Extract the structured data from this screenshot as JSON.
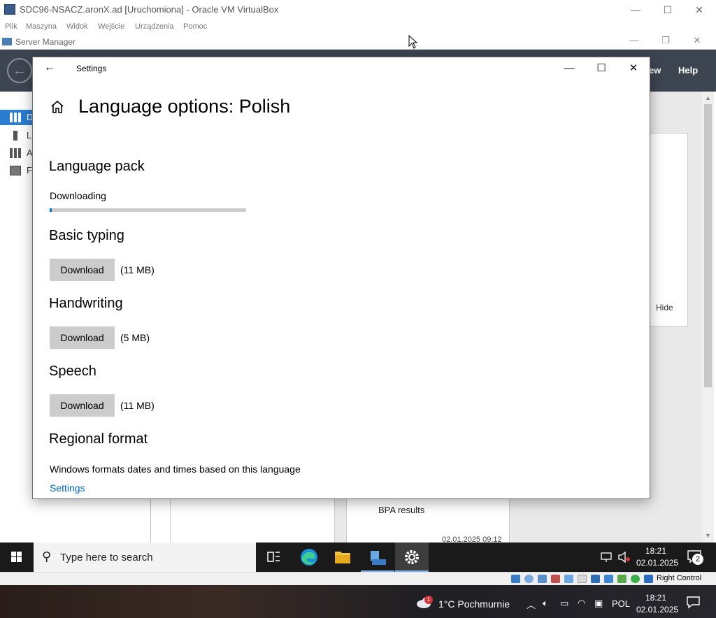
{
  "vbox": {
    "title": "SDC96-NSACZ.aronX.ad [Uruchomiona] - Oracle VM VirtualBox",
    "menu": [
      "Plik",
      "Maszyna",
      "Widok",
      "Wejście",
      "Urządzenia",
      "Pomoc"
    ],
    "controls": {
      "minimize": "—",
      "maximize": "☐",
      "close": "✕"
    },
    "status_host_key": "Right Control"
  },
  "server_manager": {
    "title": "Server Manager",
    "header_items": {
      "view": "ew",
      "help": "Help"
    },
    "sidebar": [
      {
        "label": "D",
        "active": true
      },
      {
        "label": "L",
        "active": false
      },
      {
        "label": "A",
        "active": false
      },
      {
        "label": "F",
        "active": false
      }
    ],
    "hide_label": "Hide",
    "bpa_label": "BPA results",
    "bpa_timestamp": "02.01.2025 09:12"
  },
  "settings": {
    "title": "Settings",
    "page_title": "Language options: Polish",
    "language_pack": {
      "heading": "Language pack",
      "status": "Downloading",
      "progress": 0.01
    },
    "basic_typing": {
      "heading": "Basic typing",
      "button": "Download",
      "size": "(11 MB)"
    },
    "handwriting": {
      "heading": "Handwriting",
      "button": "Download",
      "size": "(5 MB)"
    },
    "speech": {
      "heading": "Speech",
      "button": "Download",
      "size": "(11 MB)"
    },
    "regional_format": {
      "heading": "Regional format",
      "description": "Windows formats dates and times based on this language",
      "link": "Settings"
    }
  },
  "guest_taskbar": {
    "search_placeholder": "Type here to search",
    "time": "18:21",
    "date": "02.01.2025",
    "notifications_count": "2"
  },
  "host_taskbar": {
    "weather_badge": "1",
    "weather": "1°C  Pochmurnie",
    "language": "POL",
    "time": "18:21",
    "date": "02.01.2025"
  }
}
